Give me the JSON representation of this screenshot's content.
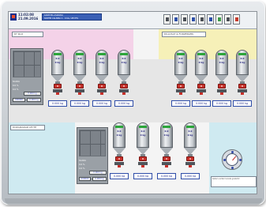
{
  "header": {
    "time": "11:02:08",
    "date": "21.09.2016",
    "info_line1": "KAPATMA ASAMASI",
    "info_line2": "SISTEM CALISMA 1 - 0 KG / ZE PTS",
    "toolbar": [
      {
        "icon": "window-icon"
      },
      {
        "icon": "silo-icon"
      },
      {
        "icon": "monitor-icon"
      },
      {
        "icon": "recipe-icon"
      },
      {
        "icon": "report-icon"
      },
      {
        "icon": "network-icon"
      },
      {
        "icon": "flag-icon"
      },
      {
        "icon": "settings-icon"
      },
      {
        "icon": "power-icon"
      }
    ]
  },
  "zones": {
    "top_left_label": "KT SILO",
    "top_right_label": "DILLOSAT & FORZERLERI",
    "bottom_left_label": "DOZAJKADAR LEYTE"
  },
  "panel_top": {
    "lines": [
      "SCADA",
      "0.0 %",
      "0.0 %"
    ],
    "val": "0.000 kg",
    "foot_left": "000000",
    "foot_right": "0.000 kg"
  },
  "panel_bottom": {
    "lines": [
      "SCADA",
      "0.0 %",
      "0.0 %"
    ],
    "val": "0.000 kg",
    "foot_left": "000000",
    "foot_right": "0.000 kg"
  },
  "silos_top_left": [
    {
      "l1": "0.0",
      "l2": "0 kg"
    },
    {
      "l1": "0.0",
      "l2": "0 kg"
    },
    {
      "l1": "0.0",
      "l2": "0 kg"
    },
    {
      "l1": "0.0",
      "l2": "0 kg"
    }
  ],
  "silos_top_right": [
    {
      "l1": "0.0",
      "l2": "0 kg"
    },
    {
      "l1": "0.0",
      "l2": "0 kg"
    },
    {
      "l1": "0.0",
      "l2": "0 kg"
    },
    {
      "l1": "0.0",
      "l2": "0 kg"
    }
  ],
  "silos_bottom": [
    {
      "l1": "0.0",
      "l2": "0 kg"
    },
    {
      "l1": "0.0",
      "l2": "0 kg"
    },
    {
      "l1": "0.0",
      "l2": "0 kg"
    },
    {
      "l1": "0.0",
      "l2": "0 kg"
    }
  ],
  "weights_top_left": [
    "0.000 kg",
    "0.000 kg",
    "0.000 kg",
    "0.000 kg"
  ],
  "weights_top_right": [
    "0.000 kg",
    "0.000 kg",
    "0.000 kg",
    "0.000 kg"
  ],
  "weights_bottom": [
    "0.000 kg",
    "0.000 kg",
    "0.000 kg",
    "0.000 kg"
  ],
  "note": "Sistem verileri burada gosterilir",
  "colors": {
    "pink_zone": "#f4d2e8",
    "yellow_zone": "#f6f0b8",
    "cyan_zone": "#cfeaf1",
    "valve_red": "#c6302a",
    "value_blue": "#1e2a8a"
  }
}
